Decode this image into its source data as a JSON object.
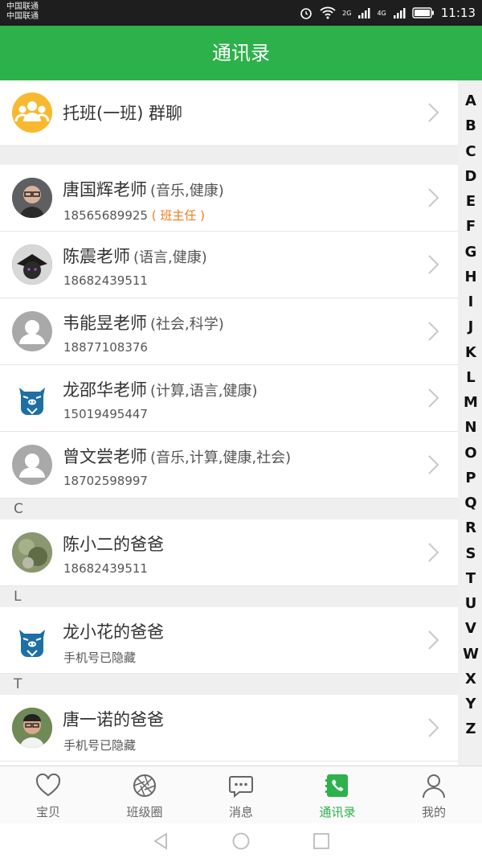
{
  "status_bar": {
    "carrier_line1": "中国联通",
    "carrier_line2": "中国联通",
    "net_2g": "2G",
    "net_4g": "4G",
    "time": "11:13"
  },
  "header": {
    "title": "通讯录"
  },
  "group_chat": {
    "name": "托班(一班) 群聊",
    "avatar_icon": "group-people-icon"
  },
  "teachers": [
    {
      "name": "唐国辉老师",
      "subjects": "(音乐,健康)",
      "phone": "18565689925",
      "role": "( 班主任 )",
      "avatar": "photo"
    },
    {
      "name": "陈震老师",
      "subjects": "(语言,健康)",
      "phone": "18682439511",
      "role": "",
      "avatar": "photo2"
    },
    {
      "name": "韦能昱老师",
      "subjects": "(社会,科学)",
      "phone": "18877108376",
      "role": "",
      "avatar": "default-person-icon"
    },
    {
      "name": "龙邵华老师",
      "subjects": "(计算,语言,健康)",
      "phone": "15019495447",
      "role": "",
      "avatar": "mascot-icon"
    },
    {
      "name": "曾文尝老师",
      "subjects": "(音乐,计算,健康,社会)",
      "phone": "18702598997",
      "role": "",
      "avatar": "default-person-icon"
    }
  ],
  "sections": [
    {
      "letter": "C",
      "name": "陈小二的爸爸",
      "phone": "18682439511",
      "avatar": "blur"
    },
    {
      "letter": "L",
      "name": "龙小花的爸爸",
      "phone": "手机号已隐藏",
      "avatar": "mascot-icon"
    },
    {
      "letter": "T",
      "name": "唐一诺的爸爸",
      "phone": "手机号已隐藏",
      "avatar": "photo"
    }
  ],
  "index_letters": [
    "A",
    "B",
    "C",
    "D",
    "E",
    "F",
    "G",
    "H",
    "I",
    "J",
    "K",
    "L",
    "M",
    "N",
    "O",
    "P",
    "Q",
    "R",
    "S",
    "T",
    "U",
    "V",
    "W",
    "X",
    "Y",
    "Z"
  ],
  "tabs": [
    {
      "label": "宝贝",
      "icon": "heart-icon",
      "active": false
    },
    {
      "label": "班级圈",
      "icon": "aperture-icon",
      "active": false
    },
    {
      "label": "消息",
      "icon": "chat-bubble-icon",
      "active": false
    },
    {
      "label": "通讯录",
      "icon": "phone-book-icon",
      "active": true
    },
    {
      "label": "我的",
      "icon": "person-icon",
      "active": false
    }
  ],
  "colors": {
    "brand_green": "#2db14b",
    "role_orange": "#ef7c1c",
    "group_avatar": "#f8b930",
    "mascot_blue": "#1d6fa4"
  }
}
